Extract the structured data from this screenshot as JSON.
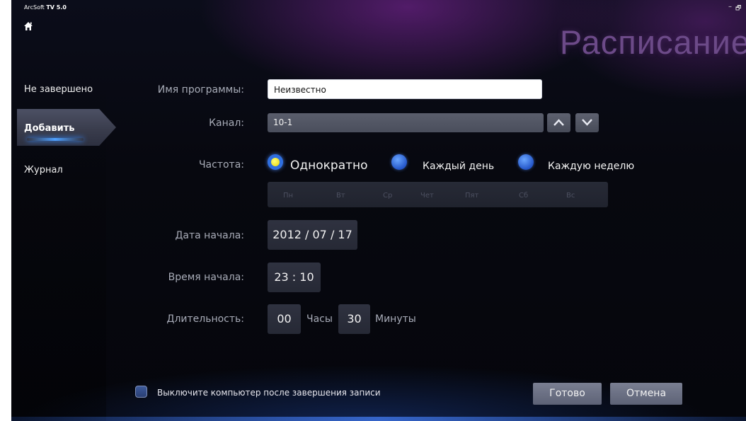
{
  "app": {
    "brand_prefix": "ArcSoft",
    "brand_name": "TV 5.0",
    "title": "Расписание",
    "minimize": "–",
    "restore": "🗗"
  },
  "sidebar": {
    "items": [
      {
        "label": "Не завершено"
      },
      {
        "label": "Добавить",
        "active": true
      },
      {
        "label": "Журнал"
      }
    ]
  },
  "form": {
    "program_name_label": "Имя программы:",
    "program_name_value": "Неизвестно",
    "channel_label": "Канал:",
    "channel_value": "10-1",
    "frequency_label": "Частота:",
    "frequency_options": [
      {
        "label": "Однократно",
        "selected": true
      },
      {
        "label": "Каждый день",
        "selected": false
      },
      {
        "label": "Каждую неделю",
        "selected": false
      }
    ],
    "days": [
      "Пн",
      "Вт",
      "Ср",
      "Чет",
      "Пят",
      "Сб",
      "Вс"
    ],
    "start_date_label": "Дата начала:",
    "start_date_value": "2012 / 07 / 17",
    "start_time_label": "Время начала:",
    "start_time_value": "23 : 10",
    "duration_label": "Длительность:",
    "duration_hours": "00",
    "hours_unit": "Часы",
    "duration_minutes": "30",
    "minutes_unit": "Минуты"
  },
  "footer": {
    "shutdown_label": "Выключите компьютер после завершения записи",
    "shutdown_checked": false,
    "ok_label": "Готово",
    "cancel_label": "Отмена"
  },
  "colors": {
    "accent": "#2f6fe0",
    "title": "#6c4a88",
    "radio_selected_dot": "#e8d400"
  }
}
